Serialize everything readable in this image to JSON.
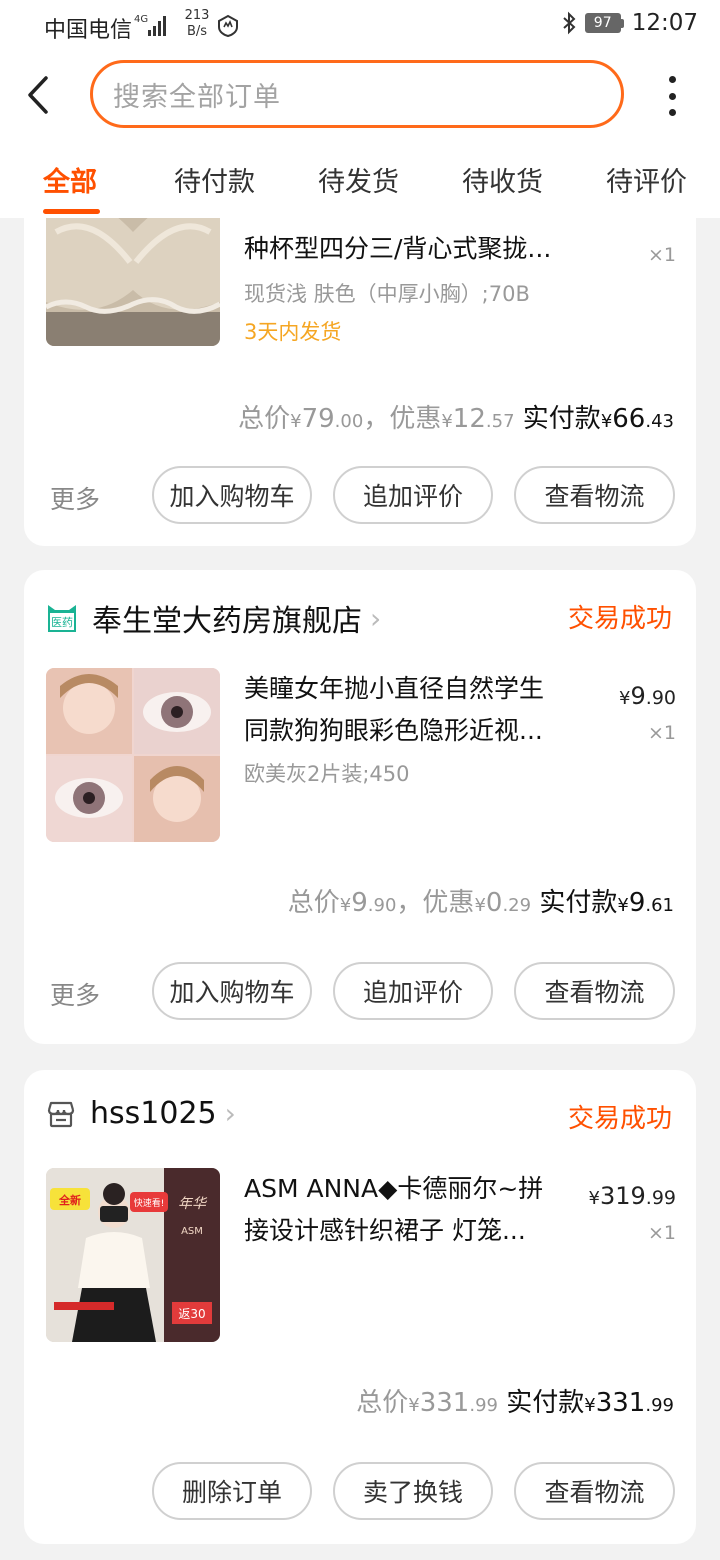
{
  "status_bar": {
    "carrier": "中国电信",
    "network": "4G",
    "speed_value": "213",
    "speed_unit": "B/s",
    "battery": "97",
    "time": "12:07"
  },
  "search": {
    "placeholder": "搜索全部订单"
  },
  "tabs": [
    {
      "label": "全部",
      "active": true
    },
    {
      "label": "待付款",
      "active": false
    },
    {
      "label": "待发货",
      "active": false
    },
    {
      "label": "待收货",
      "active": false
    },
    {
      "label": "待评价",
      "active": false
    }
  ],
  "orders": [
    {
      "item": {
        "title_lines": [
          "种杯型四分三/背心式聚拢..."
        ],
        "sku": "现货浅 肤色（中厚小胸）;70B",
        "shipping": "3天内发货",
        "qty": "×1"
      },
      "totals": {
        "total_label": "总价",
        "currency": "¥",
        "total_int": "79",
        "total_dec": ".00",
        "sep": "，",
        "discount_label": "优惠",
        "discount_int": "12",
        "discount_dec": ".57",
        "paid_label": "实付款",
        "paid_int": "66",
        "paid_dec": ".43"
      },
      "more": "更多",
      "buttons": [
        "加入购物车",
        "追加评价",
        "查看物流"
      ]
    },
    {
      "shop": "奉生堂大药房旗舰店",
      "shop_icon_text": "医药",
      "status": "交易成功",
      "item": {
        "title_lines": [
          "美瞳女年抛小直径自然学生",
          "同款狗狗眼彩色隐形近视..."
        ],
        "sku": "欧美灰2片装;450",
        "currency": "¥",
        "price_int": "9",
        "price_dec": ".90",
        "qty": "×1"
      },
      "totals": {
        "total_label": "总价",
        "currency": "¥",
        "total_int": "9",
        "total_dec": ".90",
        "sep": "，",
        "discount_label": "优惠",
        "discount_int": "0",
        "discount_dec": ".29",
        "paid_label": "实付款",
        "paid_int": "9",
        "paid_dec": ".61"
      },
      "more": "更多",
      "buttons": [
        "加入购物车",
        "追加评价",
        "查看物流"
      ]
    },
    {
      "shop": "hss1025",
      "status": "交易成功",
      "item": {
        "title_lines": [
          "ASM ANNA◆卡德丽尔~拼",
          "接设计感针织裙子 灯笼..."
        ],
        "currency": "¥",
        "price_int": "319",
        "price_dec": ".99",
        "qty": "×1",
        "thumb_texts": [
          "全新",
          "快速看!",
          "年华",
          "ASM",
          "返30"
        ]
      },
      "totals": {
        "total_label": "总价",
        "currency": "¥",
        "total_int": "331",
        "total_dec": ".99",
        "paid_label": "实付款",
        "paid_int": "331",
        "paid_dec": ".99"
      },
      "buttons": [
        "删除订单",
        "卖了换钱",
        "查看物流"
      ]
    }
  ],
  "colors": {
    "accent": "#ff5000",
    "shipping": "#f5a623",
    "shop_icon": "#1ab394"
  }
}
